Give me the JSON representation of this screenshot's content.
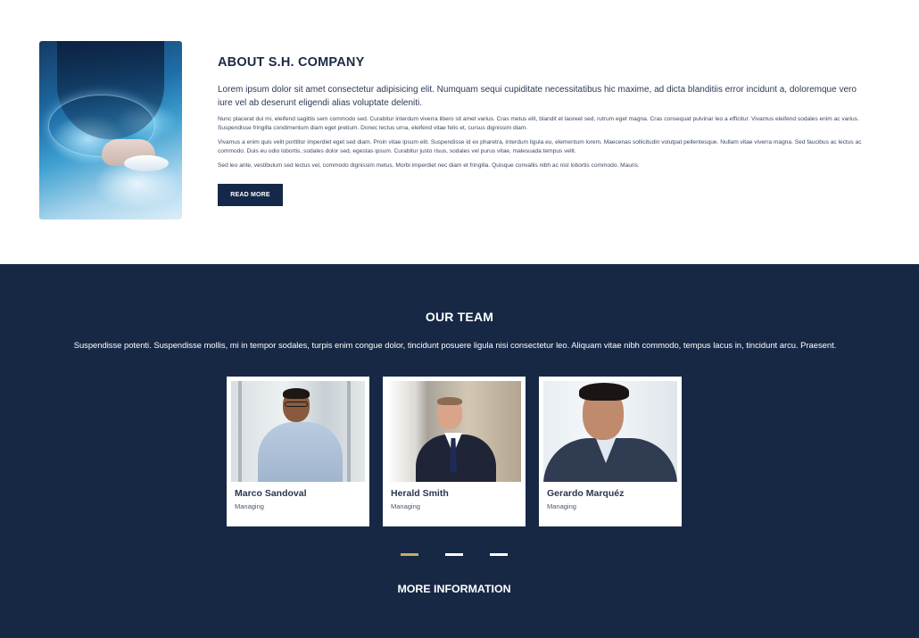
{
  "about": {
    "title": "ABOUT S.H. COMPANY",
    "lead": "Lorem ipsum dolor sit amet consectetur adipisicing elit. Numquam sequi cupiditate necessitatibus hic maxime, ad dicta blanditiis error incidunt a, doloremque vero iure vel ab deserunt eligendi alias voluptate deleniti.",
    "paragraphs": [
      "Nunc placerat dui mi, eleifend sagittis sem commodo sed. Curabitur interdum viverra libero sit amet varius. Cras metus elit, blandit et laoreet sed, rutrum eget magna. Cras consequat pulvinar leo a efficitur. Vivamus eleifend sodales enim ac varius. Suspendisse fringilla condimentum diam eget pretium. Donec lectus urna, eleifend vitae felis et, cursus dignissim diam.",
      "Vivamus a enim quis velit porttitor imperdiet eget sed diam. Proin vitae ipsum elit. Suspendisse id ex pharetra, interdum ligula eu, elementum lorem. Maecenas sollicitudin volutpat pellentesque. Nullam vitae viverra magna. Sed faucibus ac lectus ac commodo. Duis eu odio lobortis, sodales dolor sed, egestas ipsum. Curabitur justo risus, sodales vel purus vitae, malesuada tempus velit.",
      "Sed leo ante, vestibulum sed lectus vel, commodo dignissim metus. Morbi imperdiet nec diam et fringilla. Quisque convallis nibh ac nisl lobortis commodo. Mauris."
    ],
    "read_more_label": "READ MORE"
  },
  "team": {
    "title": "OUR TEAM",
    "description": "Suspendisse potenti. Suspendisse mollis, mi in tempor sodales, turpis enim congue dolor, tincidunt posuere ligula nisi consectetur leo. Aliquam vitae nibh commodo, tempus lacus in, tincidunt arcu. Praesent.",
    "members": [
      {
        "name": "Marco Sandoval",
        "role": "Managing"
      },
      {
        "name": "Herald Smith",
        "role": "Managing"
      },
      {
        "name": "Gerardo Marquéz",
        "role": "Managing"
      }
    ],
    "carousel_active_index": 0,
    "more_info_label": "MORE INFORMATION"
  },
  "colors": {
    "navy": "#172845",
    "button": "#15284a",
    "accent_gold": "#c9ac63"
  }
}
